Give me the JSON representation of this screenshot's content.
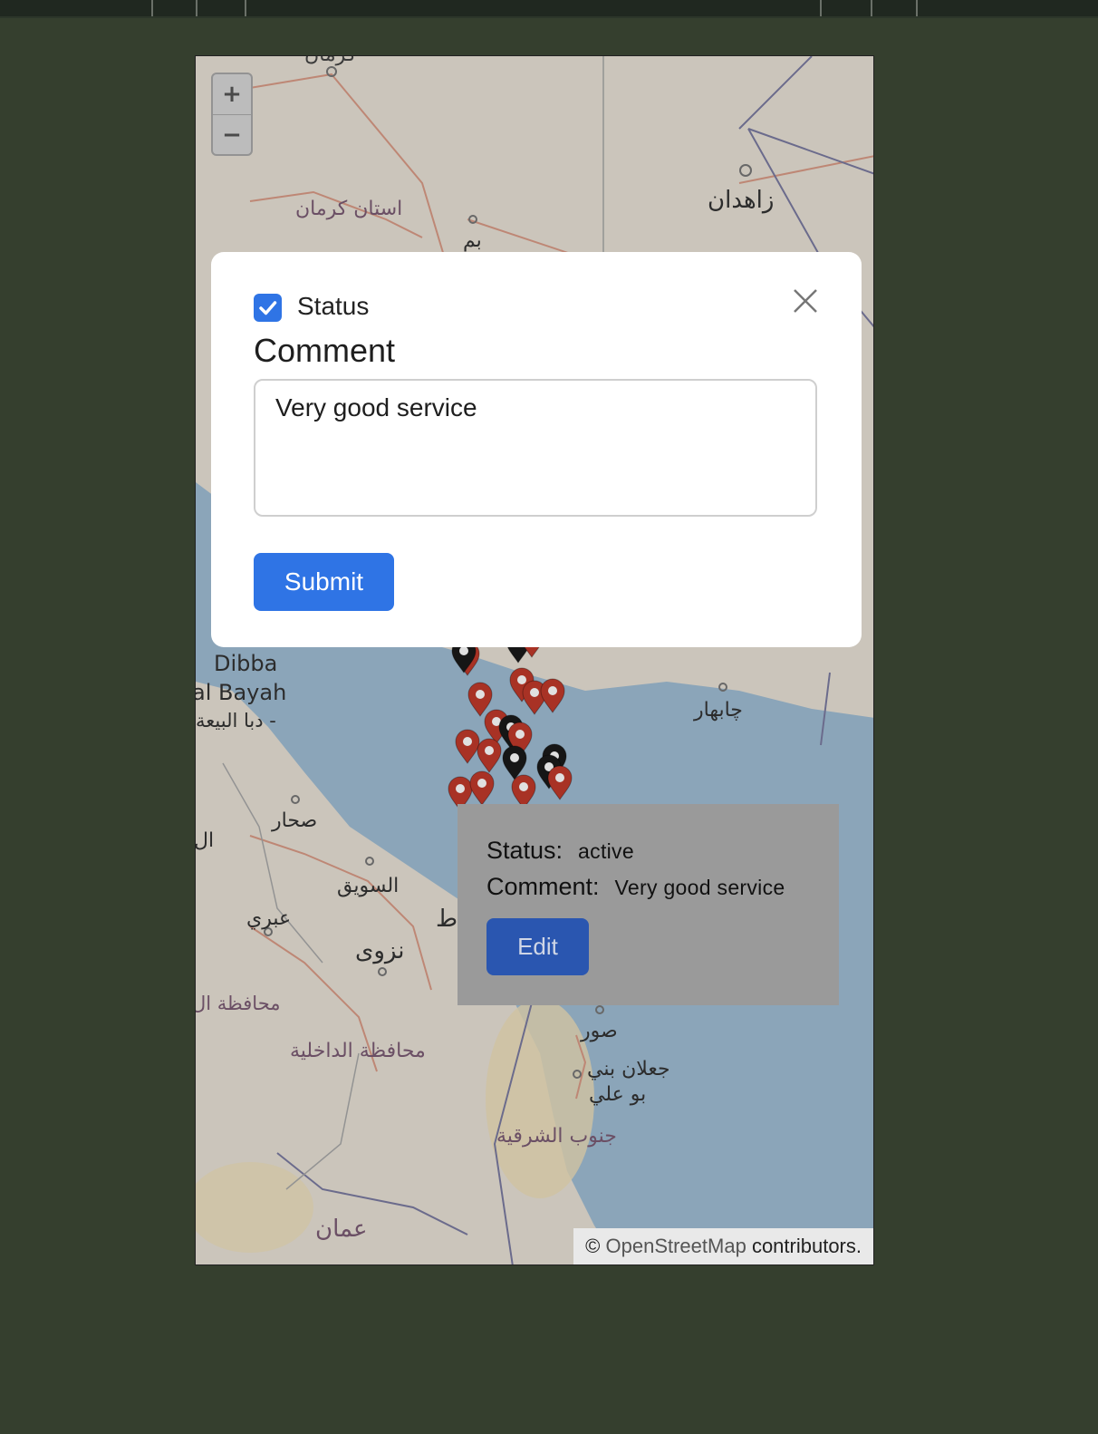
{
  "modal": {
    "status_label": "Status",
    "status_checked": true,
    "comment_label": "Comment",
    "comment_value": "Very good service",
    "submit_label": "Submit",
    "close_icon": "close-icon"
  },
  "popup": {
    "status_key": "Status:",
    "status_value": "active",
    "comment_key": "Comment:",
    "comment_value": "Very good service",
    "edit_label": "Edit"
  },
  "map": {
    "zoom_in": "+",
    "zoom_out": "−",
    "attribution_prefix": "©",
    "attribution_link": "OpenStreetMap",
    "attribution_suffix": "contributors.",
    "labels": [
      "استان کرمان",
      "زاهدان",
      "بم",
      "Dibba",
      "al Bayah",
      "دبا البيعة -",
      "چابهار",
      "صحار",
      "السويق",
      "عبري",
      "نزوى",
      "محافظة الداخلية",
      "محافظة ال",
      "صور",
      "جعلان بني",
      "بو علي",
      "جنوب الشرقية",
      "عمان",
      "كرمان",
      "ال",
      "ط"
    ],
    "marker_colors": {
      "red": "#c0392b",
      "black": "#1a1a1a"
    }
  },
  "colors": {
    "accent": "#2f74e5",
    "edit_button": "#2a56b0",
    "page_background": "#353f2e"
  }
}
